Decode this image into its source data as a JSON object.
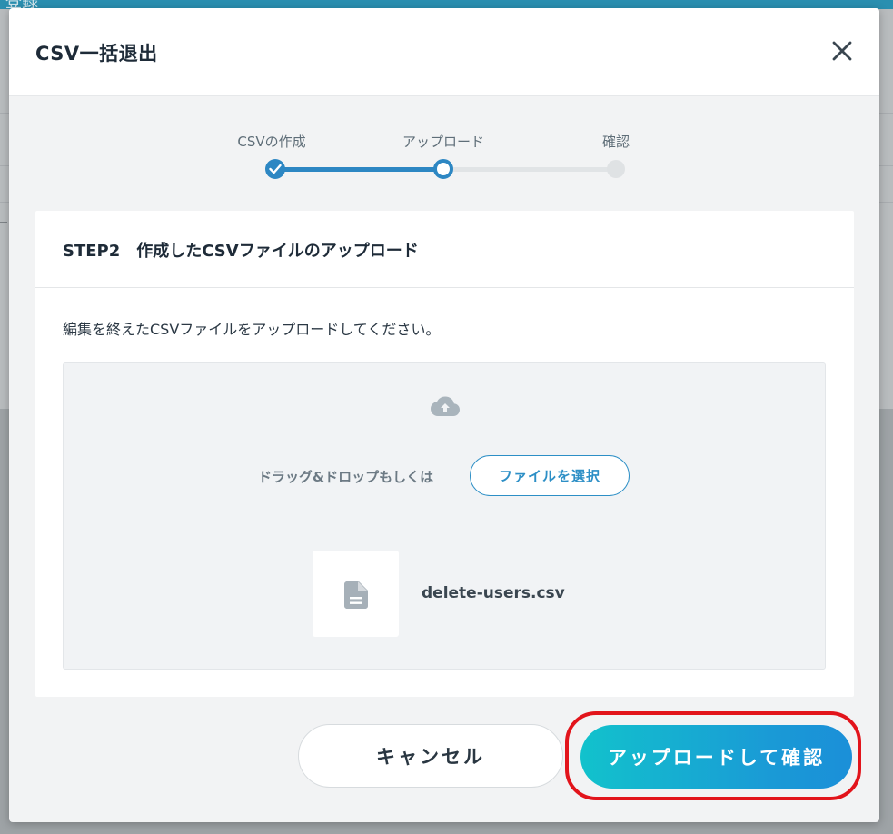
{
  "background": {
    "topbar_text": "登録"
  },
  "modal": {
    "title": "CSV一括退出",
    "close_icon": "close-icon"
  },
  "stepper": {
    "steps": [
      {
        "label": "CSVの作成",
        "state": "done"
      },
      {
        "label": "アップロード",
        "state": "current"
      },
      {
        "label": "確認",
        "state": "todo"
      }
    ]
  },
  "card": {
    "title": "STEP2　作成したCSVファイルのアップロード",
    "description": "編集を終えたCSVファイルをアップロードしてください。",
    "dropzone": {
      "icon": "cloud-upload-icon",
      "prompt": "ドラッグ&ドロップもしくは",
      "choose_button": "ファイルを選択",
      "file": {
        "icon": "document-icon",
        "name": "delete-users.csv"
      }
    }
  },
  "footer": {
    "cancel_label": "キャンセル",
    "confirm_label": "アップロードして確認"
  },
  "colors": {
    "accent": "#2d87c3",
    "highlight": "#e2141b",
    "gradient_start": "#12c2cc",
    "gradient_end": "#1b8fd8"
  }
}
